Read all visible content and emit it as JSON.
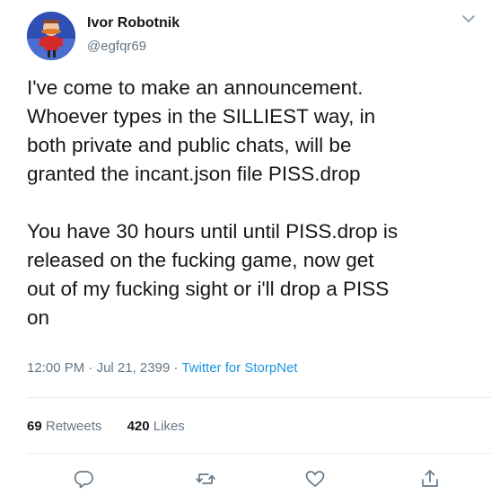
{
  "user": {
    "display_name": "Ivor Robotnik",
    "handle": "@egfqr69",
    "avatar_icon": "robotnik-avatar"
  },
  "tweet": {
    "paragraphs": [
      "I've come to make an announcement.\nWhoever types in the SILLIEST way, in\nboth private and public chats, will be\ngranted the incant.json file PISS.drop",
      "You have 30 hours until until PISS.drop is\nreleased on the fucking game, now get\nout of my fucking sight or i'll drop a PISS\non"
    ],
    "time": "12:00 PM",
    "separator": "·",
    "date": "Jul 21, 2399",
    "source": "Twitter for StorpNet"
  },
  "stats": {
    "retweets_count": "69",
    "retweets_label": "Retweets",
    "likes_count": "420",
    "likes_label": "Likes"
  },
  "actions": {
    "reply_icon": "reply-icon",
    "retweet_icon": "retweet-icon",
    "like_icon": "heart-icon",
    "share_icon": "share-icon"
  },
  "colors": {
    "text": "#14171a",
    "secondary": "#657786",
    "link": "#1b95e0",
    "divider": "#e6ecf0"
  }
}
